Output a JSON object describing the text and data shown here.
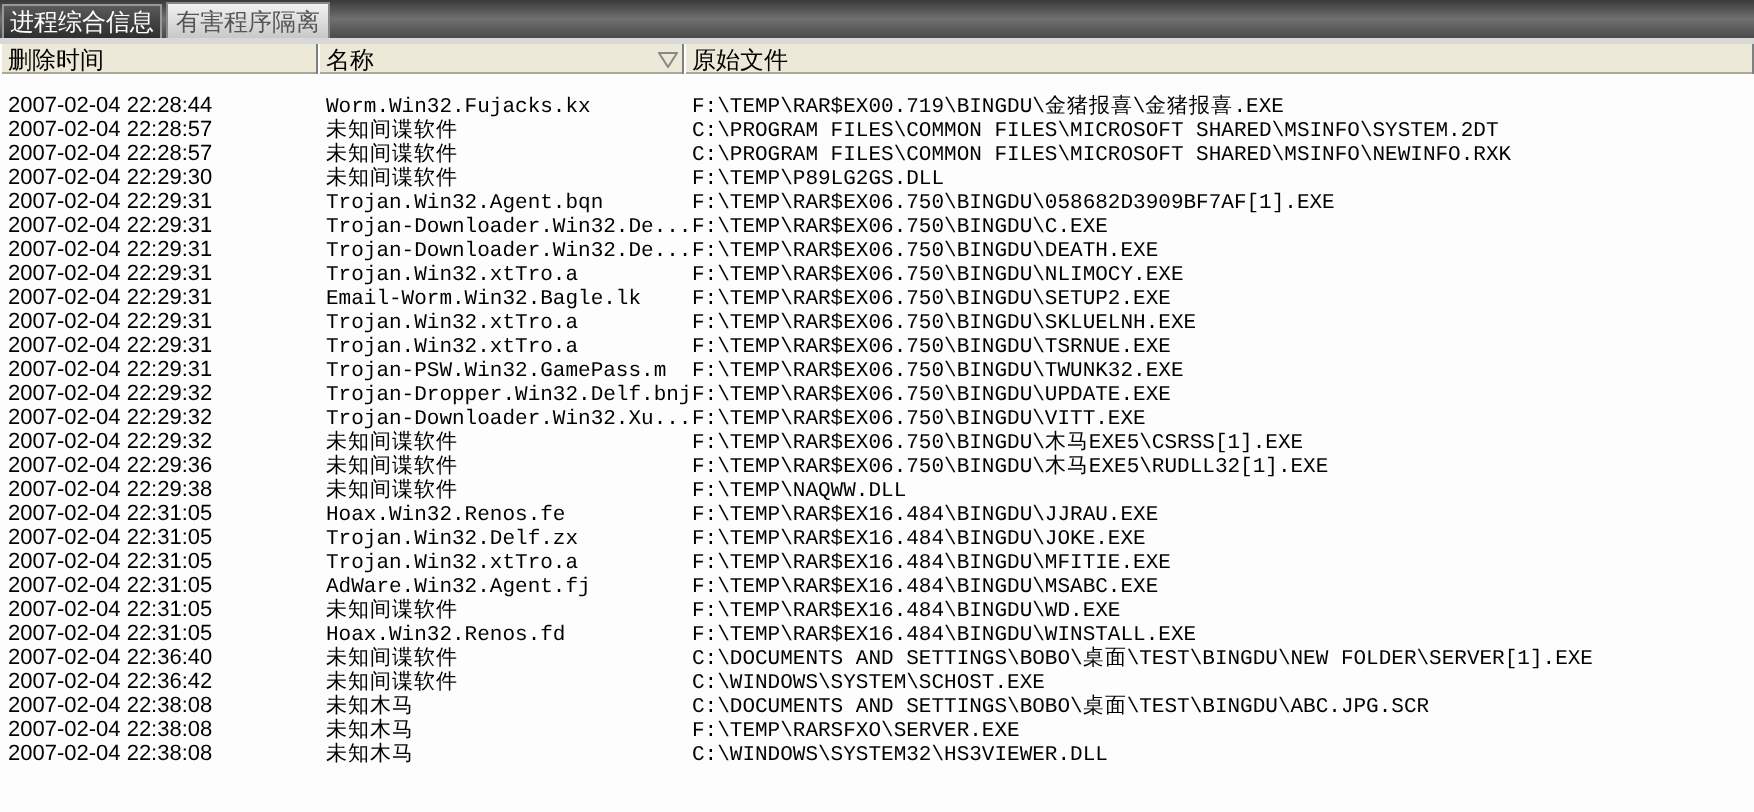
{
  "tabs": [
    {
      "label": "进程综合信息",
      "selected": false
    },
    {
      "label": "有害程序隔离",
      "selected": true
    }
  ],
  "table": {
    "columns": [
      {
        "label": "删除时间",
        "sorted": false
      },
      {
        "label": "名称",
        "sorted": true
      },
      {
        "label": "原始文件",
        "sorted": false
      }
    ],
    "rows": [
      [
        "2007-02-04 22:28:44",
        "Worm.Win32.Fujacks.kx",
        "F:\\TEMP\\RAR$EX00.719\\BINGDU\\金猪报喜\\金猪报喜.EXE"
      ],
      [
        "2007-02-04 22:28:57",
        "未知间谍软件",
        "C:\\PROGRAM FILES\\COMMON FILES\\MICROSOFT SHARED\\MSINFO\\SYSTEM.2DT"
      ],
      [
        "2007-02-04 22:28:57",
        "未知间谍软件",
        "C:\\PROGRAM FILES\\COMMON FILES\\MICROSOFT SHARED\\MSINFO\\NEWINFO.RXK"
      ],
      [
        "2007-02-04 22:29:30",
        "未知间谍软件",
        "F:\\TEMP\\P89LG2GS.DLL"
      ],
      [
        "2007-02-04 22:29:31",
        "Trojan.Win32.Agent.bqn",
        "F:\\TEMP\\RAR$EX06.750\\BINGDU\\058682D3909BF7AF[1].EXE"
      ],
      [
        "2007-02-04 22:29:31",
        "Trojan-Downloader.Win32.De...",
        "F:\\TEMP\\RAR$EX06.750\\BINGDU\\C.EXE"
      ],
      [
        "2007-02-04 22:29:31",
        "Trojan-Downloader.Win32.De...",
        "F:\\TEMP\\RAR$EX06.750\\BINGDU\\DEATH.EXE"
      ],
      [
        "2007-02-04 22:29:31",
        "Trojan.Win32.xtTro.a",
        "F:\\TEMP\\RAR$EX06.750\\BINGDU\\NLIMOCY.EXE"
      ],
      [
        "2007-02-04 22:29:31",
        "Email-Worm.Win32.Bagle.lk",
        "F:\\TEMP\\RAR$EX06.750\\BINGDU\\SETUP2.EXE"
      ],
      [
        "2007-02-04 22:29:31",
        "Trojan.Win32.xtTro.a",
        "F:\\TEMP\\RAR$EX06.750\\BINGDU\\SKLUELNH.EXE"
      ],
      [
        "2007-02-04 22:29:31",
        "Trojan.Win32.xtTro.a",
        "F:\\TEMP\\RAR$EX06.750\\BINGDU\\TSRNUE.EXE"
      ],
      [
        "2007-02-04 22:29:31",
        "Trojan-PSW.Win32.GamePass.m",
        "F:\\TEMP\\RAR$EX06.750\\BINGDU\\TWUNK32.EXE"
      ],
      [
        "2007-02-04 22:29:32",
        "Trojan-Dropper.Win32.Delf.bnj",
        "F:\\TEMP\\RAR$EX06.750\\BINGDU\\UPDATE.EXE"
      ],
      [
        "2007-02-04 22:29:32",
        "Trojan-Downloader.Win32.Xu...",
        "F:\\TEMP\\RAR$EX06.750\\BINGDU\\VITT.EXE"
      ],
      [
        "2007-02-04 22:29:32",
        "未知间谍软件",
        "F:\\TEMP\\RAR$EX06.750\\BINGDU\\木马EXE5\\CSRSS[1].EXE"
      ],
      [
        "2007-02-04 22:29:36",
        "未知间谍软件",
        "F:\\TEMP\\RAR$EX06.750\\BINGDU\\木马EXE5\\RUDLL32[1].EXE"
      ],
      [
        "2007-02-04 22:29:38",
        "未知间谍软件",
        "F:\\TEMP\\NAQWW.DLL"
      ],
      [
        "2007-02-04 22:31:05",
        "Hoax.Win32.Renos.fe",
        "F:\\TEMP\\RAR$EX16.484\\BINGDU\\JJRAU.EXE"
      ],
      [
        "2007-02-04 22:31:05",
        "Trojan.Win32.Delf.zx",
        "F:\\TEMP\\RAR$EX16.484\\BINGDU\\JOKE.EXE"
      ],
      [
        "2007-02-04 22:31:05",
        "Trojan.Win32.xtTro.a",
        "F:\\TEMP\\RAR$EX16.484\\BINGDU\\MFITIE.EXE"
      ],
      [
        "2007-02-04 22:31:05",
        "AdWare.Win32.Agent.fj",
        "F:\\TEMP\\RAR$EX16.484\\BINGDU\\MSABC.EXE"
      ],
      [
        "2007-02-04 22:31:05",
        "未知间谍软件",
        "F:\\TEMP\\RAR$EX16.484\\BINGDU\\WD.EXE"
      ],
      [
        "2007-02-04 22:31:05",
        "Hoax.Win32.Renos.fd",
        "F:\\TEMP\\RAR$EX16.484\\BINGDU\\WINSTALL.EXE"
      ],
      [
        "2007-02-04 22:36:40",
        "未知间谍软件",
        "C:\\DOCUMENTS AND SETTINGS\\BOBO\\桌面\\TEST\\BINGDU\\NEW FOLDER\\SERVER[1].EXE"
      ],
      [
        "2007-02-04 22:36:42",
        "未知间谍软件",
        "C:\\WINDOWS\\SYSTEM\\SCHOST.EXE"
      ],
      [
        "2007-02-04 22:38:08",
        "未知木马",
        "C:\\DOCUMENTS AND SETTINGS\\BOBO\\桌面\\TEST\\BINGDU\\ABC.JPG.SCR"
      ],
      [
        "2007-02-04 22:38:08",
        "未知木马",
        "F:\\TEMP\\RARSFXO\\SERVER.EXE"
      ],
      [
        "2007-02-04 22:38:08",
        "未知木马",
        "C:\\WINDOWS\\SYSTEM32\\HS3VIEWER.DLL"
      ]
    ]
  }
}
